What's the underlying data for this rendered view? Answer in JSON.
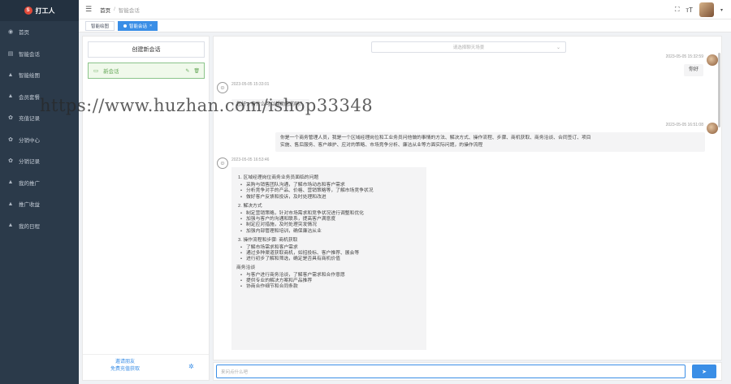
{
  "app": {
    "logo_text": "打工人",
    "logo_mark": "S"
  },
  "sidebar": {
    "items": [
      {
        "label": "首页",
        "icon": "dashboard-icon",
        "glyph": "◉"
      },
      {
        "label": "智能会话",
        "icon": "chat-icon",
        "glyph": "▤"
      },
      {
        "label": "智能绘图",
        "icon": "user-icon",
        "glyph": "▲"
      },
      {
        "label": "会员套餐",
        "icon": "user-icon",
        "glyph": "▲"
      },
      {
        "label": "充值记录",
        "icon": "gear-icon",
        "glyph": "✿"
      },
      {
        "label": "分销中心",
        "icon": "gear-icon",
        "glyph": "✿"
      },
      {
        "label": "分销记录",
        "icon": "gear-icon",
        "glyph": "✿"
      },
      {
        "label": "我的推广",
        "icon": "user-icon",
        "glyph": "▲"
      },
      {
        "label": "推广收益",
        "icon": "user-icon",
        "glyph": "▲"
      },
      {
        "label": "我的日程",
        "icon": "user-icon",
        "glyph": "▲"
      }
    ]
  },
  "header": {
    "breadcrumb_home": "首页",
    "breadcrumb_sep": "/",
    "breadcrumb_current": "智能会话"
  },
  "tabs": [
    {
      "label": "智能绘图"
    },
    {
      "label": "智能会话",
      "close": "×"
    }
  ],
  "conversations": {
    "new_chat_label": "创建新会话",
    "items": [
      {
        "label": "新会话"
      }
    ],
    "footer_line1": "邀请朋友",
    "footer_line2": "免费充值获取"
  },
  "chat": {
    "scene_placeholder": "请选择聊天场景",
    "messages": [
      {
        "role": "user",
        "time": "2023-05-05 15:32:59",
        "text": "你好"
      },
      {
        "role": "bot",
        "time": "2023-05-05 15:33:01",
        "text": "您好，有什么可以帮助您的吗？"
      },
      {
        "role": "user",
        "time": "2023-05-05 16:51:08",
        "line1": "你是一个商务管理人员，我是一个区域经理岗位和工业务员问他做的事情的方法、解决方式、操作流程、步骤、商机获取、商务洽谈、合同签订、项目",
        "line2": "实施、售后服务、客户维护、应对的策略、市场竞争分析、廉洁从业等方面实际问题，的操作流程"
      },
      {
        "role": "bot",
        "time": "2023-05-05 16:53:46"
      }
    ],
    "reply": {
      "s1_title": "1. 区域经理岗位商务业务员面临的问题",
      "s1_items": [
        "采购与销售团队沟通，了解市场动态和客户需求",
        "分析竞争对手的产品、价格、营销策略等，了解市场竞争状况",
        "做好客户反馈和投诉，及时处理和改进"
      ],
      "s2_title": "2. 解决方式",
      "s2_items": [
        "制定营销策略，针对市场需求和竞争状况进行调整和优化",
        "加强与客户的沟通和联系，提高客户满意度",
        "制定应对措施，及时处理突发情况",
        "加强内部管理和培训，确保廉洁从业"
      ],
      "s3_title": "3. 操作流程和步骤: 商机获取",
      "s3_items": [
        "了解市场需求和客户需求",
        "通过多种渠道获取商机，如招投标、客户推荐、展会等",
        "进行初步了解和筛选，确定是否具有商机价值"
      ],
      "s4_title": "商务洽谈",
      "s4_items": [
        "与客户进行商务洽谈，了解客户需求和合作意愿",
        "提供专业的解决方案和产品推荐",
        "协商合作细节和合同条款"
      ]
    },
    "input_placeholder": "来问点什么吧",
    "send_glyph": "➤"
  },
  "watermark": "https://www.huzhan.com/ishop33348"
}
